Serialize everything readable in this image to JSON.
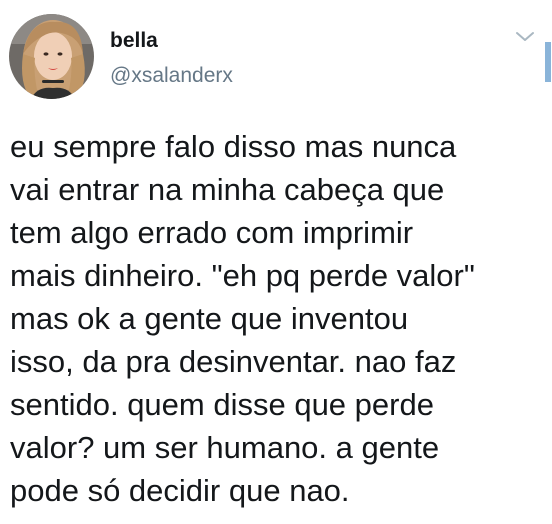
{
  "author": {
    "display_name": "bella",
    "handle": "@xsalanderx",
    "avatar_icon": "profile-photo"
  },
  "controls": {
    "menu_icon": "chevron-down-icon"
  },
  "tweet": {
    "lines": [
      "eu sempre falo disso mas nunca",
      "vai entrar na minha cabeça que",
      "tem algo errado com imprimir",
      "mais dinheiro. \"eh pq perde valor\"",
      "mas ok a gente que inventou",
      "isso, da pra desinventar. nao faz",
      "sentido. quem disse que perde",
      "valor? um ser humano. a gente",
      "pode só decidir que nao."
    ]
  },
  "colors": {
    "text": "#14171a",
    "secondary": "#657786",
    "accent_edge": "#8ab4d9"
  }
}
